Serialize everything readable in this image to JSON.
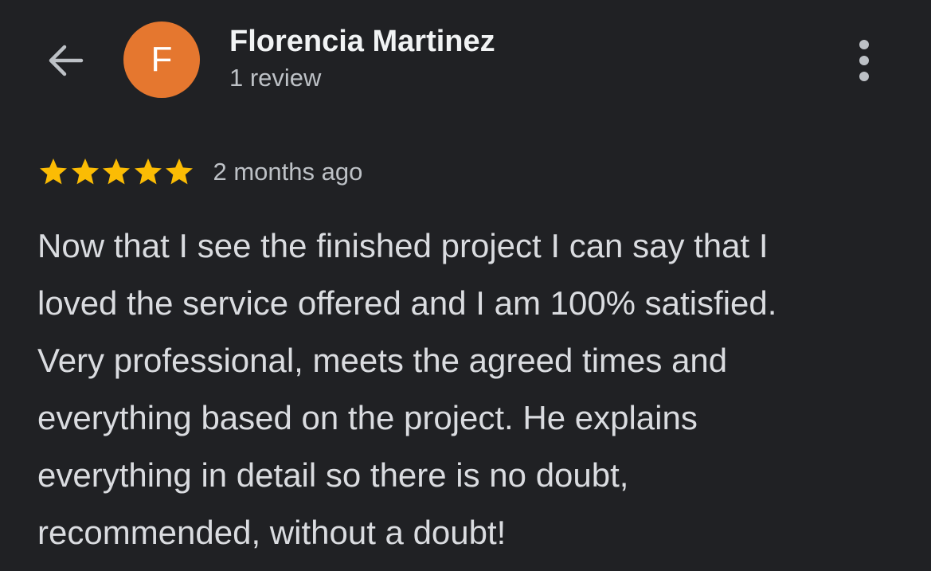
{
  "header": {
    "back_icon": "arrow-left-icon",
    "avatar_initial": "F",
    "avatar_color": "#e5772f",
    "reviewer_name": "Florencia Martinez",
    "review_count": "1 review",
    "more_icon": "more-vert-icon"
  },
  "review": {
    "rating": 5,
    "rating_max": 5,
    "star_color": "#fbbc04",
    "star_icon": "star-icon",
    "time": "2 months ago",
    "text_lines": [
      "Now that I see the finished project I can say that I",
      "loved the service offered and I am 100% satisfied.",
      "Very professional, meets the agreed times and",
      "everything based on the project. He explains",
      "everything in detail so there is no doubt,",
      "recommended, without a doubt!"
    ]
  },
  "colors": {
    "background": "#202124",
    "primary_text": "#f1f3f4",
    "secondary_text": "#bdc1c6"
  }
}
